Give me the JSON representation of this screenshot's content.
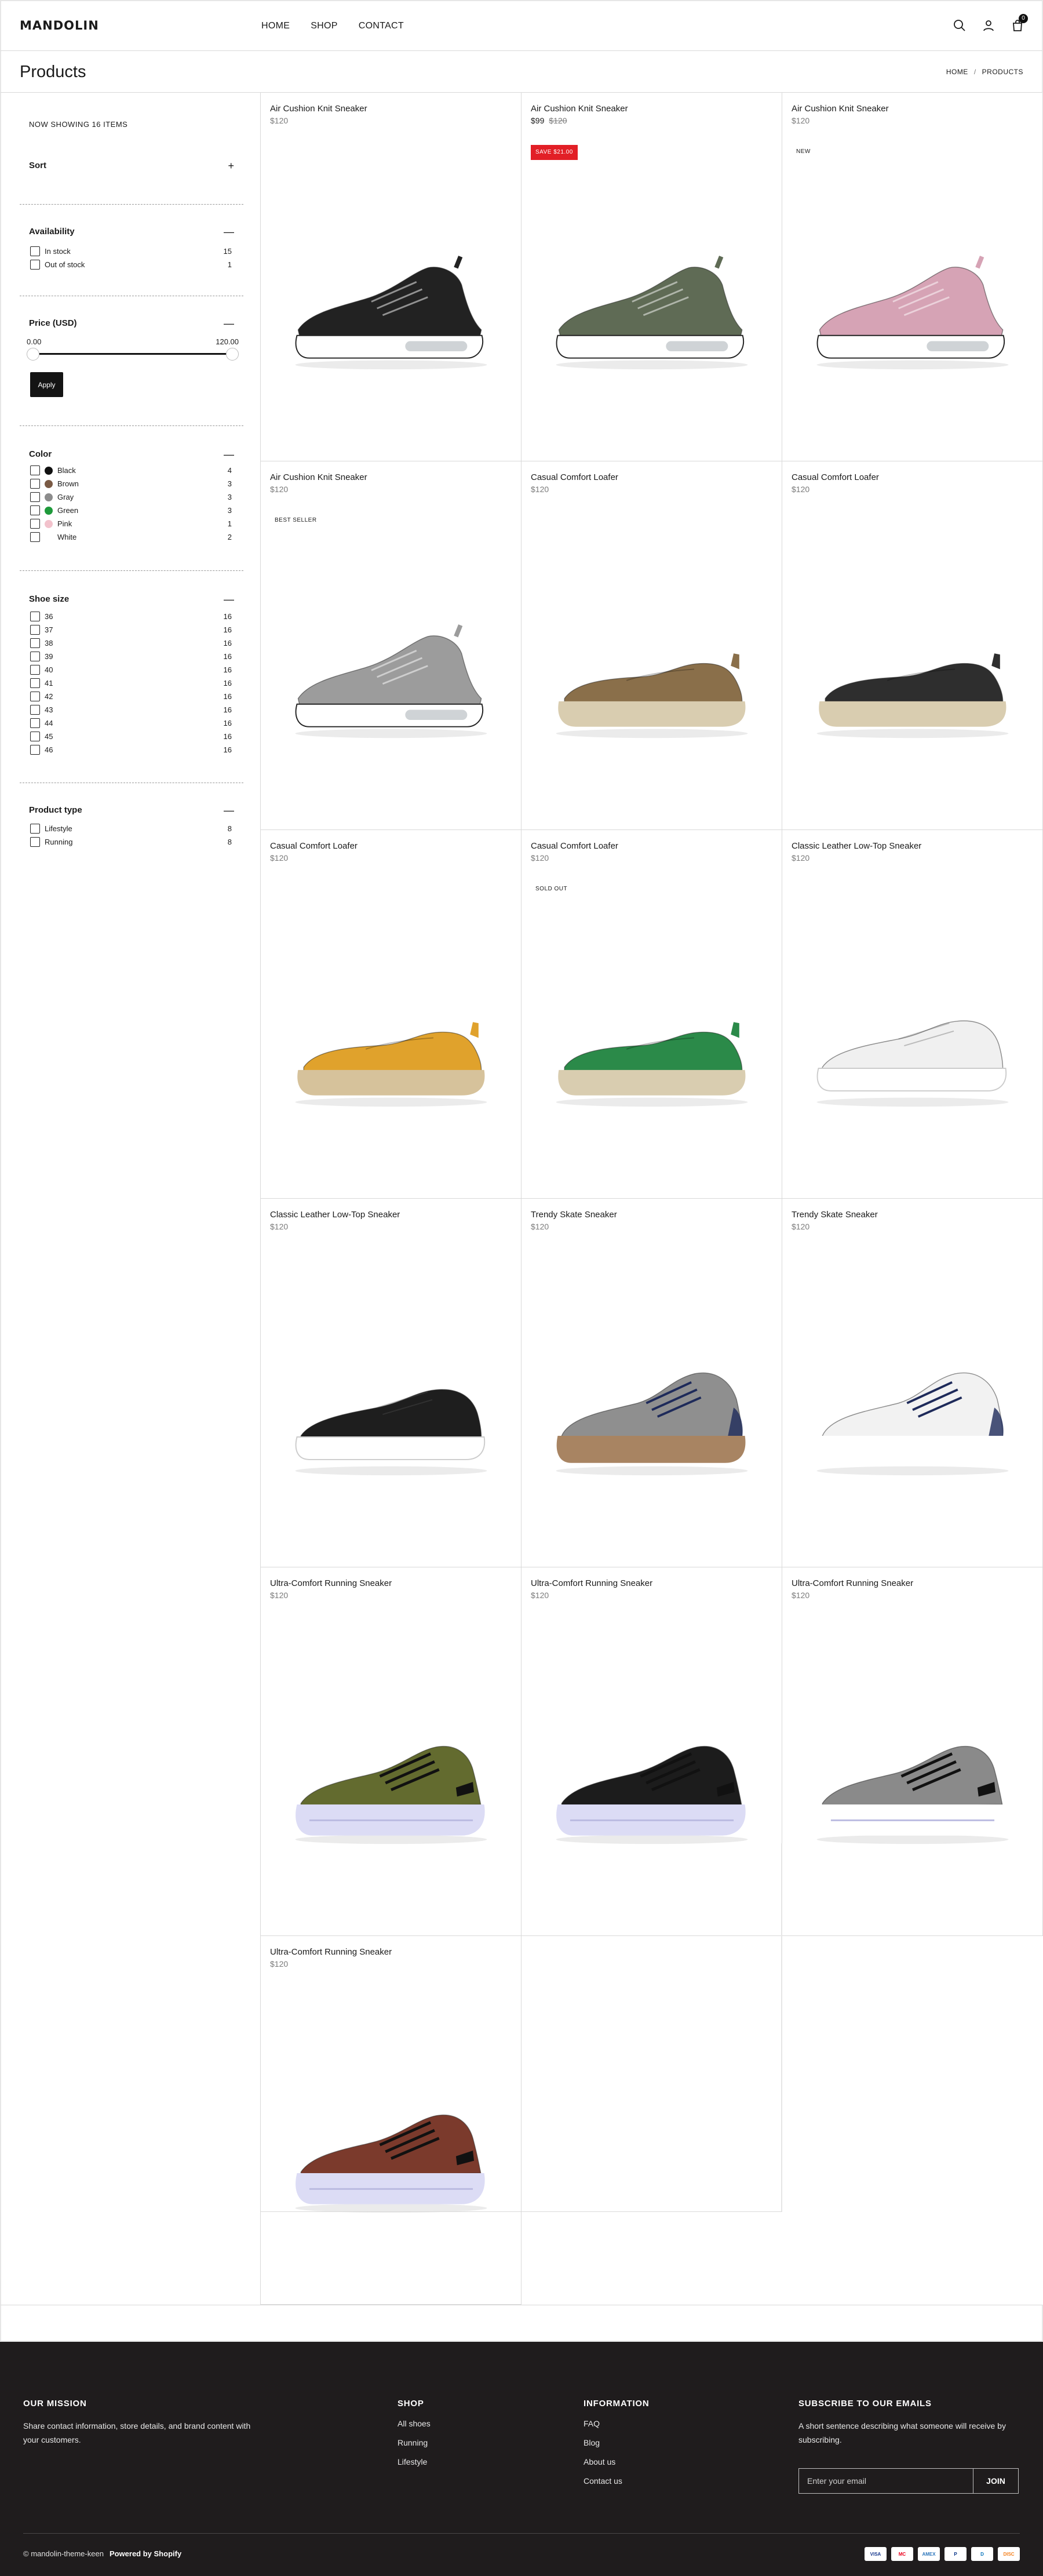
{
  "header": {
    "logo": "MANDOLIN",
    "nav": [
      "HOME",
      "SHOP",
      "CONTACT"
    ],
    "cart_count": "0"
  },
  "page": {
    "title": "Products",
    "breadcrumb": [
      "HOME",
      "PRODUCTS"
    ]
  },
  "sidebar": {
    "showing": "NOW SHOWING 16 ITEMS",
    "sort_label": "Sort",
    "availability": {
      "label": "Availability",
      "options": [
        {
          "label": "In stock",
          "count": "15"
        },
        {
          "label": "Out of stock",
          "count": "1"
        }
      ]
    },
    "price": {
      "label": "Price (USD)",
      "min": "0.00",
      "max": "120.00",
      "apply_label": "Apply"
    },
    "color": {
      "label": "Color",
      "options": [
        {
          "label": "Black",
          "count": "4",
          "swatch": "#111111"
        },
        {
          "label": "Brown",
          "count": "3",
          "swatch": "#7a5a44"
        },
        {
          "label": "Gray",
          "count": "3",
          "swatch": "#8c8c8c"
        },
        {
          "label": "Green",
          "count": "3",
          "swatch": "#1f9a3b"
        },
        {
          "label": "Pink",
          "count": "1",
          "swatch": "#f2c2cc"
        },
        {
          "label": "White",
          "count": "2",
          "swatch": "#ffffff"
        }
      ]
    },
    "shoe_size": {
      "label": "Shoe size",
      "options": [
        {
          "label": "36",
          "count": "16"
        },
        {
          "label": "37",
          "count": "16"
        },
        {
          "label": "38",
          "count": "16"
        },
        {
          "label": "39",
          "count": "16"
        },
        {
          "label": "40",
          "count": "16"
        },
        {
          "label": "41",
          "count": "16"
        },
        {
          "label": "42",
          "count": "16"
        },
        {
          "label": "43",
          "count": "16"
        },
        {
          "label": "44",
          "count": "16"
        },
        {
          "label": "45",
          "count": "16"
        },
        {
          "label": "46",
          "count": "16"
        }
      ]
    },
    "product_type": {
      "label": "Product type",
      "options": [
        {
          "label": "Lifestyle",
          "count": "8"
        },
        {
          "label": "Running",
          "count": "8"
        }
      ]
    }
  },
  "products": [
    {
      "title": "Air Cushion Knit Sneaker",
      "price": "$120",
      "compare": "",
      "badge": "",
      "color": "#222222",
      "sole": "#ffffff",
      "style": "knit"
    },
    {
      "title": "Air Cushion Knit Sneaker",
      "price": "$99",
      "compare": "$120",
      "badge": "SAVE $21.00",
      "color": "#5f6b55",
      "sole": "#ffffff",
      "style": "knit"
    },
    {
      "title": "Air Cushion Knit Sneaker",
      "price": "$120",
      "compare": "",
      "badge": "NEW",
      "color": "#d6a3b5",
      "sole": "#ffffff",
      "style": "knit"
    },
    {
      "title": "Air Cushion Knit Sneaker",
      "price": "$120",
      "compare": "",
      "badge": "BEST SELLER",
      "color": "#9c9c9c",
      "sole": "#ffffff",
      "style": "knit"
    },
    {
      "title": "Casual Comfort Loafer",
      "price": "$120",
      "compare": "",
      "badge": "",
      "color": "#8a6f4a",
      "sole": "#d9cdb0",
      "style": "loafer"
    },
    {
      "title": "Casual Comfort Loafer",
      "price": "$120",
      "compare": "",
      "badge": "",
      "color": "#2e2e2e",
      "sole": "#d9cdb0",
      "style": "loafer"
    },
    {
      "title": "Casual Comfort Loafer",
      "price": "$120",
      "compare": "",
      "badge": "",
      "color": "#e0a22c",
      "sole": "#d6c29b",
      "style": "loafer"
    },
    {
      "title": "Casual Comfort Loafer",
      "price": "$120",
      "compare": "",
      "badge": "SOLD OUT",
      "color": "#2b8a49",
      "sole": "#d9cdb0",
      "style": "loafer"
    },
    {
      "title": "Classic Leather Low-Top Sneaker",
      "price": "$120",
      "compare": "",
      "badge": "",
      "color": "#f0f0f0",
      "sole": "#ffffff",
      "style": "lowtop"
    },
    {
      "title": "Classic Leather Low-Top Sneaker",
      "price": "$120",
      "compare": "",
      "badge": "",
      "color": "#1e1e1e",
      "sole": "#ffffff",
      "style": "lowtop"
    },
    {
      "title": "Trendy Skate Sneaker",
      "price": "$120",
      "compare": "",
      "badge": "",
      "color": "#8f8f8f",
      "sole": "#a88462",
      "style": "skate"
    },
    {
      "title": "Trendy Skate Sneaker",
      "price": "$120",
      "compare": "",
      "badge": "",
      "color": "#f2f2f2",
      "sole": "#ffffff",
      "style": "skate"
    },
    {
      "title": "Ultra-Comfort Running Sneaker",
      "price": "$120",
      "compare": "",
      "badge": "",
      "color": "#636b2f",
      "sole": "#dcdcf5",
      "style": "runner"
    },
    {
      "title": "Ultra-Comfort Running Sneaker",
      "price": "$120",
      "compare": "",
      "badge": "",
      "color": "#1c1c1c",
      "sole": "#dcdcf5",
      "style": "runner"
    },
    {
      "title": "Ultra-Comfort Running Sneaker",
      "price": "$120",
      "compare": "",
      "badge": "",
      "color": "#8a8a8a",
      "sole": "#ffffff",
      "style": "runner"
    },
    {
      "title": "Ultra-Comfort Running Sneaker",
      "price": "$120",
      "compare": "",
      "badge": "",
      "color": "#7b3a2c",
      "sole": "#dcdcf5",
      "style": "runner"
    }
  ],
  "footer": {
    "mission": {
      "heading": "OUR MISSION",
      "text": "Share contact information, store details, and brand content with your customers."
    },
    "shop": {
      "heading": "SHOP",
      "links": [
        "All shoes",
        "Running",
        "Lifestyle"
      ]
    },
    "information": {
      "heading": "INFORMATION",
      "links": [
        "FAQ",
        "Blog",
        "About us",
        "Contact us"
      ]
    },
    "subscribe": {
      "heading": "SUBSCRIBE TO OUR EMAILS",
      "text": "A short sentence describing what someone will receive by subscribing.",
      "placeholder": "Enter your email",
      "button": "JOIN"
    },
    "copyright": "© mandolin-theme-keen",
    "powered": "Powered by Shopify",
    "payments": [
      "VISA",
      "MC",
      "AMEX",
      "P",
      "D",
      "DISC"
    ]
  }
}
